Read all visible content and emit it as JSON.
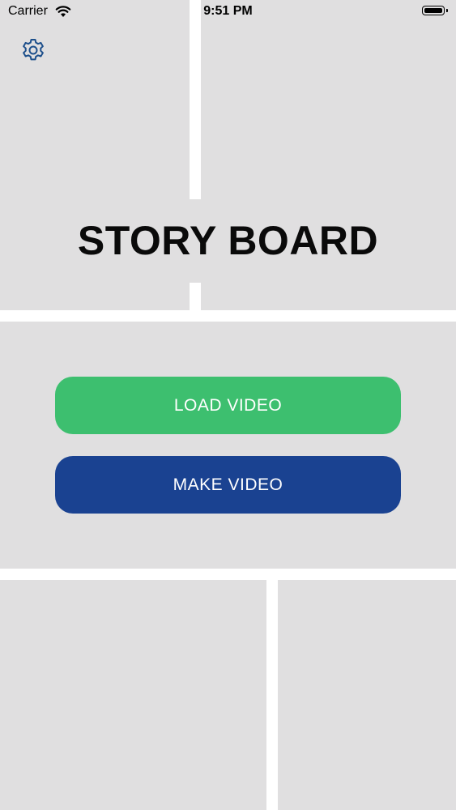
{
  "status_bar": {
    "carrier": "Carrier",
    "time": "9:51 PM",
    "wifi_icon": "wifi-icon",
    "battery_icon": "battery-icon"
  },
  "settings": {
    "icon": "gear-icon",
    "color": "#1d4f8b"
  },
  "title": "STORY BOARD",
  "buttons": {
    "load_video": {
      "label": "LOAD VIDEO",
      "color": "#3dbf6f"
    },
    "make_video": {
      "label": "MAKE VIDEO",
      "color": "#1a4291"
    }
  },
  "colors": {
    "panel": "#e0dfe0",
    "divider": "#ffffff"
  }
}
